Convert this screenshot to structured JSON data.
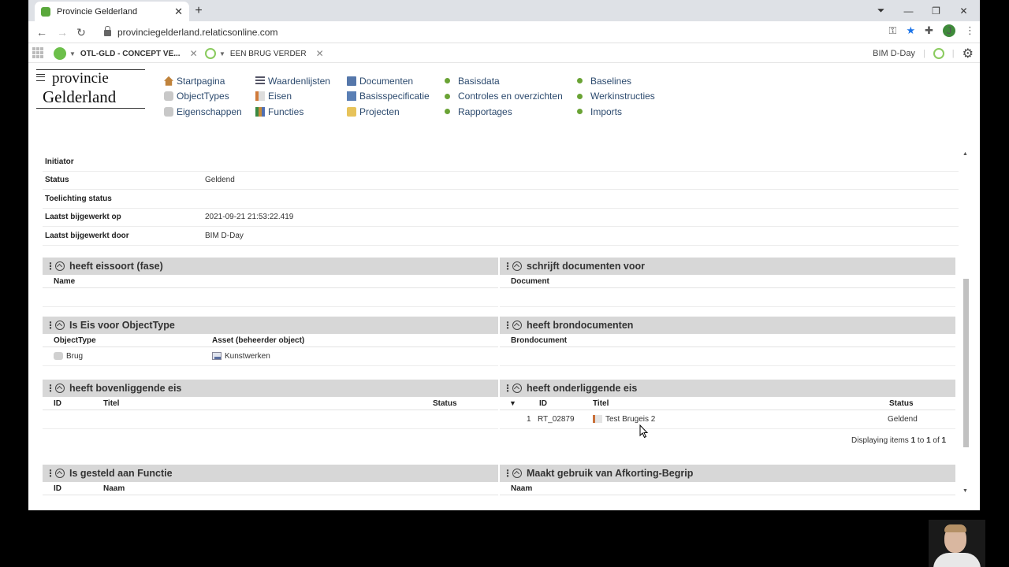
{
  "browser": {
    "tab_title": "Provincie Gelderland",
    "url": "provinciegelderland.relaticsonline.com",
    "avatar_letter": "J"
  },
  "appbar": {
    "tabs": [
      {
        "label": "OTL-GLD - CONCEPT VE..."
      },
      {
        "label": "EEN BRUG VERDER"
      }
    ],
    "user": "BIM D-Day"
  },
  "brand": {
    "line1": "provincie",
    "line2": "Gelderland"
  },
  "nav": {
    "col1": [
      "Startpagina",
      "ObjectTypes",
      "Eigenschappen"
    ],
    "col2": [
      "Waardenlijsten",
      "Eisen",
      "Functies"
    ],
    "col3": [
      "Documenten",
      "Basisspecificatie",
      "Projecten"
    ],
    "col4": [
      "Basisdata",
      "Controles en overzichten",
      "Rapportages"
    ],
    "col5": [
      "Baselines",
      "Werkinstructies",
      "Imports"
    ]
  },
  "properties": [
    {
      "label": "Initiator",
      "value": ""
    },
    {
      "label": "Status",
      "value": "Geldend"
    },
    {
      "label": "Toelichting status",
      "value": ""
    },
    {
      "label": "Laatst bijgewerkt op",
      "value": "2021-09-21 21:53:22.419"
    },
    {
      "label": "Laatst bijgewerkt door",
      "value": "BIM D-Day"
    }
  ],
  "panels": {
    "eissoort": {
      "title": "heeft eissoort (fase)",
      "col1": "Name"
    },
    "schrijft": {
      "title": "schrijft documenten voor",
      "col1": "Document"
    },
    "objecttype": {
      "title": "Is Eis voor ObjectType",
      "col1": "ObjectType",
      "col2": "Asset (beheerder object)",
      "row": {
        "objecttype": "Brug",
        "asset": "Kunstwerken"
      }
    },
    "brondoc": {
      "title": "heeft brondocumenten",
      "col1": "Brondocument"
    },
    "boven": {
      "title": "heeft bovenliggende eis",
      "col1": "ID",
      "col2": "Titel",
      "col3": "Status"
    },
    "onder": {
      "title": "heeft onderliggende eis",
      "sort": "▼",
      "col1": "ID",
      "col2": "Titel",
      "col3": "Status",
      "row": {
        "num": "1",
        "id": "RT_02879",
        "titel": "Test Brugeis 2",
        "status": "Geldend"
      },
      "paging_prefix": "Displaying items ",
      "paging_from": "1",
      "paging_to_word": " to ",
      "paging_to": "1",
      "paging_of_word": " of ",
      "paging_total": "1"
    },
    "functie": {
      "title": "Is gesteld aan Functie",
      "col1": "ID",
      "col2": "Naam"
    },
    "afkorting": {
      "title": "Maakt gebruik van Afkorting-Begrip",
      "col1": "Naam"
    }
  }
}
